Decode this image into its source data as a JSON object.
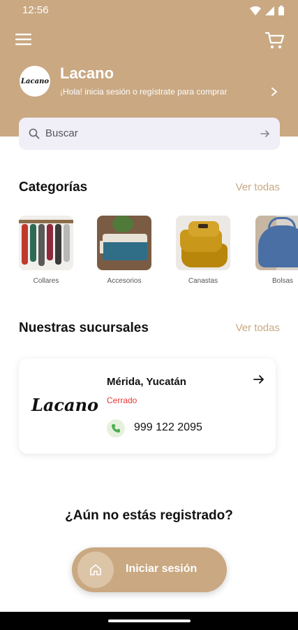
{
  "status_bar": {
    "time": "12:56",
    "icons": [
      "wifi-icon",
      "signal-icon",
      "battery-icon"
    ]
  },
  "header": {
    "brand_logo_text": "Lacano",
    "brand_name": "Lacano",
    "subtitle": "¡Hola! inicia sesión o regístrate para comprar"
  },
  "search": {
    "placeholder": "Buscar"
  },
  "categories": {
    "title": "Categorías",
    "see_all": "Ver todas",
    "items": [
      {
        "label": "Collares"
      },
      {
        "label": "Accesorios"
      },
      {
        "label": "Canastas"
      },
      {
        "label": "Bolsas"
      }
    ]
  },
  "branches": {
    "title": "Nuestras sucursales",
    "see_all": "Ver todas",
    "items": [
      {
        "logo_text": "Lacano",
        "city": "Mérida, Yucatán",
        "status": "Cerrado",
        "phone": "999 122 2095"
      }
    ]
  },
  "register": {
    "question": "¿Aún no estás registrado?",
    "login_label": "Iniciar sesión"
  },
  "colors": {
    "brand": "#c9a882",
    "closed": "#e53935",
    "search_bg": "#f0eef7"
  }
}
